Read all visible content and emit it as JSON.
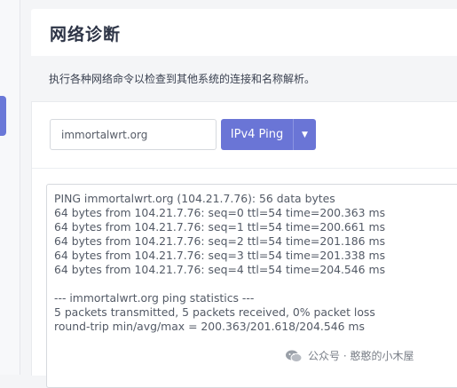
{
  "header": {
    "title": "网络诊断"
  },
  "description": "执行各种网络命令以检查到其他系统的连接和名称解析。",
  "controls": {
    "host_value": "immortalwrt.org",
    "ping_label": "IPv4 Ping",
    "dropdown_glyph": "▼"
  },
  "output": {
    "lines": [
      "PING immortalwrt.org (104.21.7.76): 56 data bytes",
      "64 bytes from 104.21.7.76: seq=0 ttl=54 time=200.363 ms",
      "64 bytes from 104.21.7.76: seq=1 ttl=54 time=200.661 ms",
      "64 bytes from 104.21.7.76: seq=2 ttl=54 time=201.186 ms",
      "64 bytes from 104.21.7.76: seq=3 ttl=54 time=201.338 ms",
      "64 bytes from 104.21.7.76: seq=4 ttl=54 time=204.546 ms",
      "",
      "--- immortalwrt.org ping statistics ---",
      "5 packets transmitted, 5 packets received, 0% packet loss",
      "round-trip min/avg/max = 200.363/201.618/204.546 ms"
    ]
  },
  "watermark": {
    "text": "公众号 · 憨憨的小木屋"
  },
  "colors": {
    "accent": "#6a75d6",
    "sidebar_accent": "#6a78d8"
  }
}
